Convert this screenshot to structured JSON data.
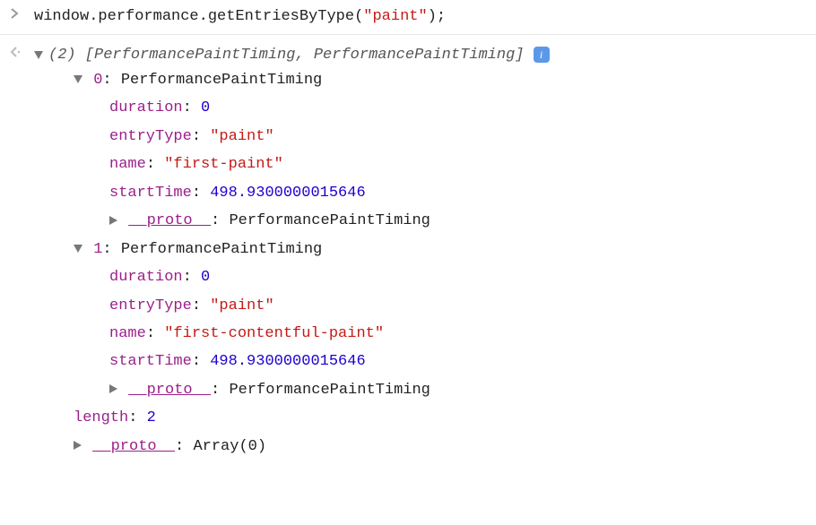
{
  "input": {
    "prefix": "window.performance.",
    "method": "getEntriesByType",
    "arg": "\"paint\"",
    "suffix": ");"
  },
  "output": {
    "count": "(2)",
    "summary": " [PerformancePaintTiming, PerformancePaintTiming] ",
    "entries": [
      {
        "index": "0",
        "typeName": "PerformancePaintTiming",
        "props": {
          "duration": "0",
          "entryType": "\"paint\"",
          "name": "\"first-paint\"",
          "startTime": "498.9300000015646"
        },
        "protoLabel": "__proto__",
        "protoValue": "PerformancePaintTiming"
      },
      {
        "index": "1",
        "typeName": "PerformancePaintTiming",
        "props": {
          "duration": "0",
          "entryType": "\"paint\"",
          "name": "\"first-contentful-paint\"",
          "startTime": "498.9300000015646"
        },
        "protoLabel": "__proto__",
        "protoValue": "PerformancePaintTiming"
      }
    ],
    "lengthKey": "length",
    "lengthValue": "2",
    "arrayProtoLabel": "__proto__",
    "arrayProtoValue": "Array(0)"
  },
  "labels": {
    "durationKey": "duration",
    "entryTypeKey": "entryType",
    "nameKey": "name",
    "startTimeKey": "startTime"
  }
}
